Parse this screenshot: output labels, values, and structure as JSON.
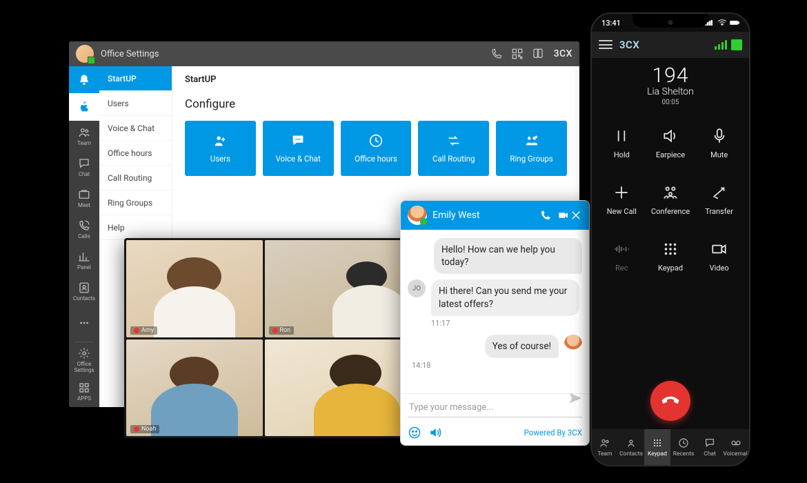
{
  "desktop": {
    "header": {
      "title": "Office Settings",
      "brand": "3CX"
    },
    "rail": [
      {
        "key": "bell",
        "icon": "bell",
        "label": ""
      },
      {
        "key": "apple",
        "icon": "apple",
        "label": ""
      },
      {
        "key": "team",
        "icon": "team",
        "label": "Team"
      },
      {
        "key": "chat",
        "icon": "chat",
        "label": "Chat"
      },
      {
        "key": "meet",
        "icon": "meet",
        "label": "Meet"
      },
      {
        "key": "calls",
        "icon": "calls",
        "label": "Calls"
      },
      {
        "key": "panel",
        "icon": "panel",
        "label": "Panel"
      },
      {
        "key": "contacts",
        "icon": "contacts",
        "label": "Contacts"
      },
      {
        "key": "more",
        "icon": "more",
        "label": ""
      },
      {
        "key": "settings",
        "icon": "gear",
        "label": "Office\nSettings"
      },
      {
        "key": "apps",
        "icon": "apps",
        "label": "APPS"
      }
    ],
    "sub_sidebar": [
      "StartUP",
      "Users",
      "Voice & Chat",
      "Office hours",
      "Call Routing",
      "Ring Groups",
      "Help"
    ],
    "sub_active_index": 0,
    "main": {
      "title": "StartUP",
      "subtitle": "Configure",
      "tiles": [
        {
          "icon": "user-add",
          "label": "Users"
        },
        {
          "icon": "chat-dots",
          "label": "Voice & Chat"
        },
        {
          "icon": "clock",
          "label": "Office hours"
        },
        {
          "icon": "route",
          "label": "Call Routing"
        },
        {
          "icon": "group-add",
          "label": "Ring Groups"
        }
      ]
    }
  },
  "video_meeting": {
    "participants": [
      {
        "name": "Amy",
        "muted": true
      },
      {
        "name": "Ron",
        "muted": true
      },
      {
        "name": "Noah",
        "muted": true
      },
      {
        "name": "",
        "muted": false
      }
    ]
  },
  "chat": {
    "agent_name": "Emily West",
    "messages": [
      {
        "side": "out",
        "text": "Hello! How can we help you today?",
        "time": ""
      },
      {
        "side": "in",
        "avatar": "JO",
        "text": "Hi there! Can you send me your latest offers?",
        "time": "11:17"
      },
      {
        "side": "out",
        "avatar": "photo",
        "text": "Yes of course!",
        "time": "14:18"
      }
    ],
    "input_placeholder": "Type your message...",
    "powered_by": "Powered By 3CX"
  },
  "phone": {
    "status_bar": {
      "time": "13:41"
    },
    "brand": "3CX",
    "call": {
      "extension": "194",
      "name": "Lia Shelton",
      "duration": "00:05"
    },
    "buttons": [
      {
        "icon": "pause",
        "label": "Hold",
        "disabled": false
      },
      {
        "icon": "speaker",
        "label": "Earpiece",
        "disabled": false
      },
      {
        "icon": "mic",
        "label": "Mute",
        "disabled": false
      },
      {
        "icon": "plus",
        "label": "New Call",
        "disabled": false
      },
      {
        "icon": "conf",
        "label": "Conference",
        "disabled": false
      },
      {
        "icon": "transfer",
        "label": "Transfer",
        "disabled": false
      },
      {
        "icon": "rec",
        "label": "Rec",
        "disabled": true
      },
      {
        "icon": "keypad",
        "label": "Keypad",
        "disabled": false
      },
      {
        "icon": "video",
        "label": "Video",
        "disabled": false
      }
    ],
    "tabs": [
      {
        "icon": "team",
        "label": "Team"
      },
      {
        "icon": "contacts",
        "label": "Contacts"
      },
      {
        "icon": "keypad",
        "label": "Keypad"
      },
      {
        "icon": "recents",
        "label": "Recents"
      },
      {
        "icon": "chat",
        "label": "Chat"
      },
      {
        "icon": "vm",
        "label": "Voicemail"
      }
    ],
    "active_tab_index": 2
  },
  "colors": {
    "accent": "#0098e4",
    "danger": "#e4342f",
    "ok": "#2fcf2f"
  }
}
